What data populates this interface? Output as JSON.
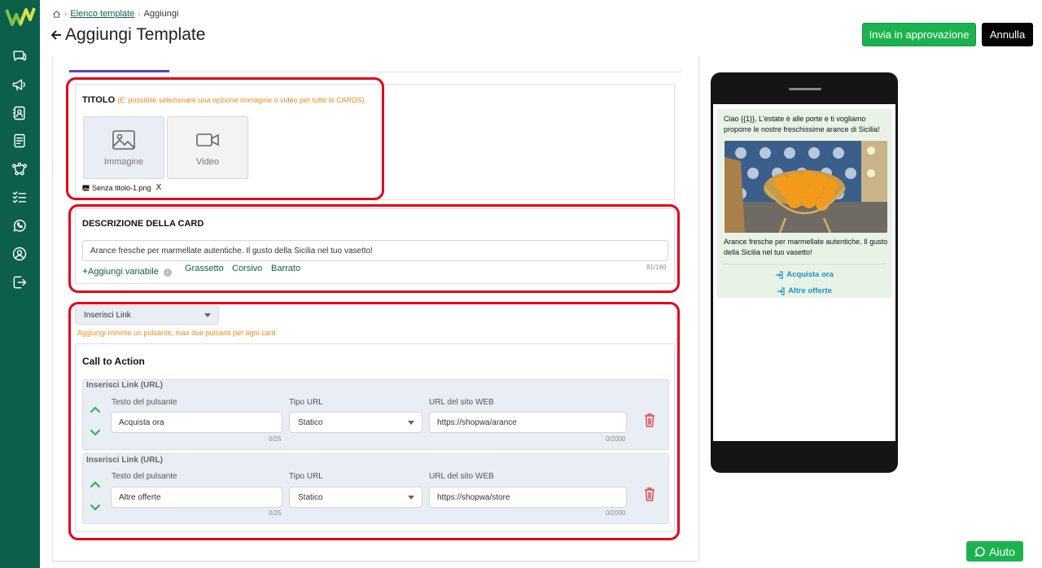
{
  "breadcrumb": {
    "parent": "Elenco template",
    "current": "Aggiungi"
  },
  "page": {
    "title": "Aggiungi Template"
  },
  "header_buttons": {
    "submit": "Invia in approvazione",
    "cancel": "Annulla"
  },
  "sidebar": {
    "items": [
      "chat-icon",
      "megaphone-icon",
      "contacts-icon",
      "document-icon",
      "flow-icon",
      "checklist-icon",
      "whatsapp-icon",
      "user-circle-icon",
      "logout-icon"
    ]
  },
  "title_section": {
    "label": "TITOLO",
    "hint": "(E' possibile selezionare una opzione immagine o video per tutte le CARDS)",
    "options": [
      "Immagine",
      "Video"
    ],
    "file_name": "Senza titolo-1.png",
    "remove": "X"
  },
  "description_section": {
    "label": "DESCRIZIONE DELLA CARD",
    "value": "Arance fresche per marmellate autentiche. Il gusto della Sicilia nel tuo vasetto!",
    "add_variable": "Aggiungi variabile",
    "bold": "Grassetto",
    "italic": "Corsivo",
    "strike": "Barrato",
    "counter": "81/160"
  },
  "buttons_section": {
    "selector": "Inserisci Link",
    "hint": "Aggiungi minimo un pulsante, max due pulsanti per ogni card",
    "cta_title": "Call to Action",
    "button_text_label": "Testo del pulsante",
    "url_type_label": "Tipo URL",
    "url_label": "URL del sito WEB",
    "items": [
      {
        "header": "Inserisci Link (URL)",
        "text": "Acquista ora",
        "text_counter": "0/25",
        "url_type": "Statico",
        "url": "https://shopwa/arance",
        "url_counter": "0/2000"
      },
      {
        "header": "Inserisci Link (URL)",
        "text": "Altre offerte",
        "text_counter": "0/25",
        "url_type": "Statico",
        "url": "https://shopwa/store",
        "url_counter": "0/2000"
      }
    ]
  },
  "preview": {
    "message": "Ciao {{1}}, L'estate è alle porte e ti vogliamo proporre le nostre freschissime arance di Sicilia!",
    "caption": "Arance fresche per marmellate autentiche. Il gusto della Sicilia nel tuo vasetto!",
    "links": [
      "Acquista ora",
      "Altre offerte"
    ]
  },
  "help": {
    "label": "Aiuto"
  },
  "colors": {
    "sidebar": "#0b5f4b",
    "primary": "#1cb34f",
    "highlight": "#e3001b",
    "accent_tab": "#5b3fd0"
  }
}
